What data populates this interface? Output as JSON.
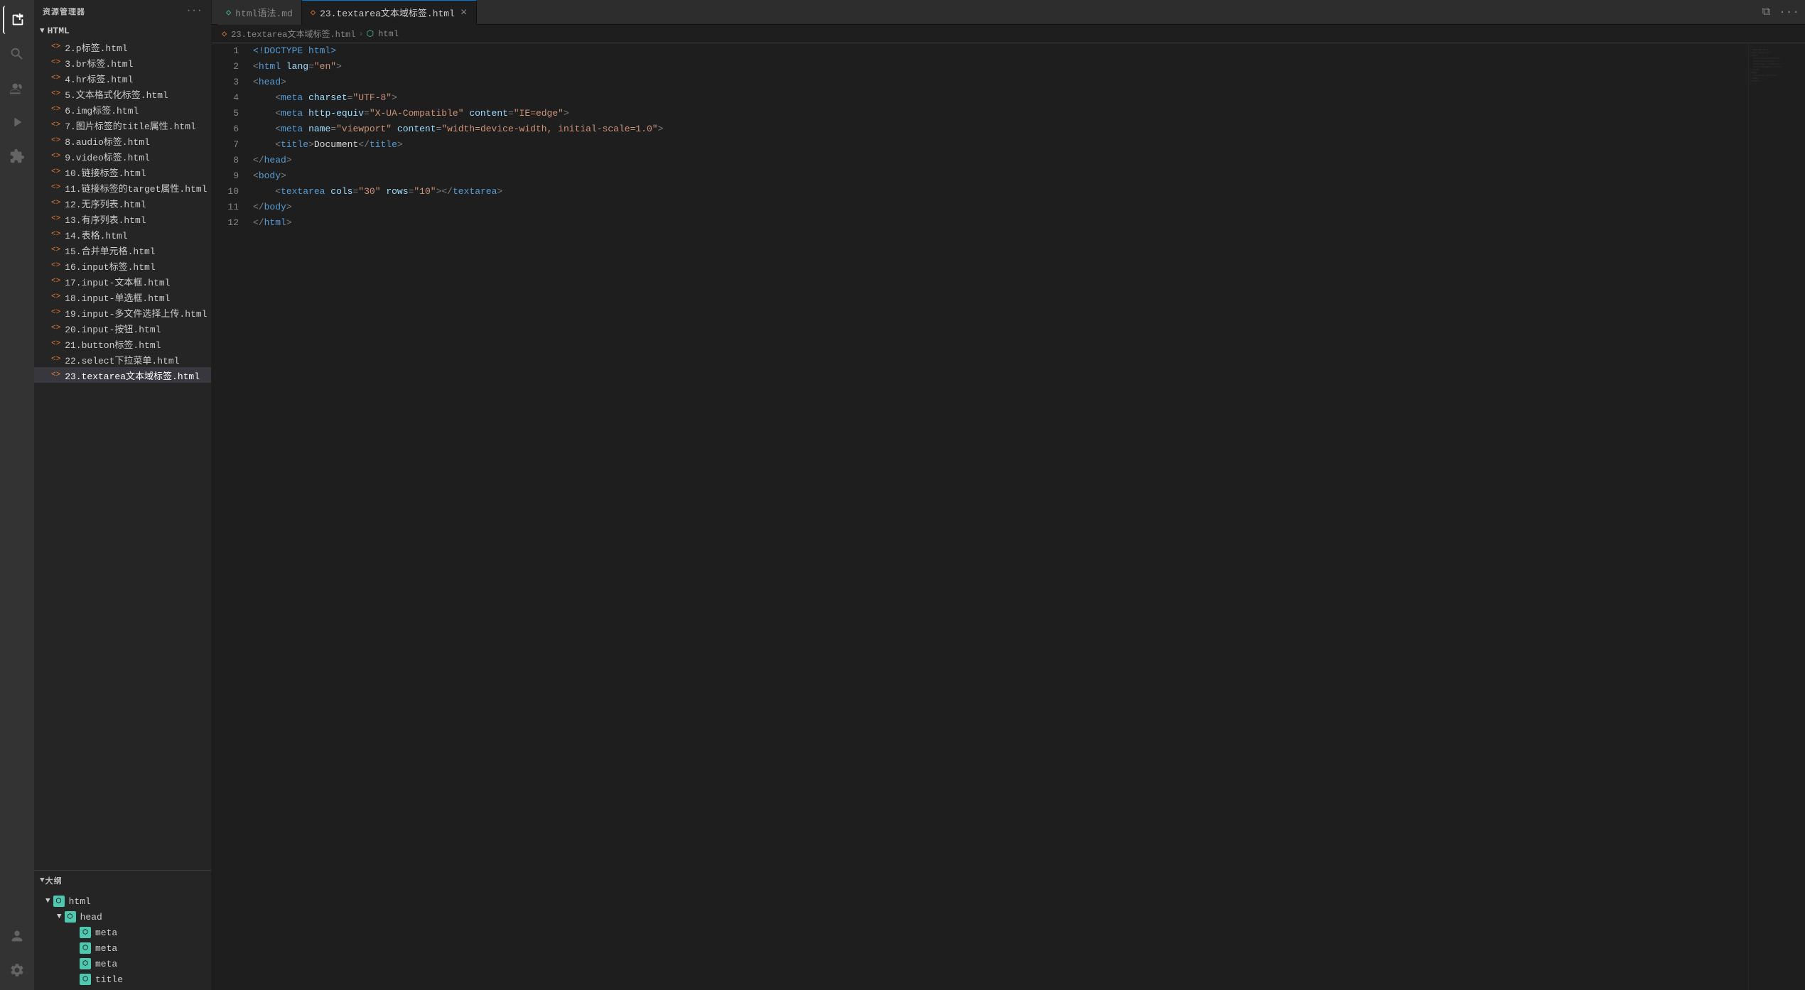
{
  "titleBar": {
    "tabs": [
      {
        "id": "tab-md",
        "icon": "◇",
        "label": "html语法.md",
        "active": false,
        "closable": false,
        "iconColor": "#4ec9b0"
      },
      {
        "id": "tab-html",
        "icon": "◇",
        "label": "23.textarea文本域标签.html",
        "active": true,
        "closable": true,
        "iconColor": "#e37933"
      }
    ]
  },
  "activityBar": {
    "icons": [
      {
        "id": "explorer",
        "symbol": "⎘",
        "active": true,
        "label": "explorer-icon"
      },
      {
        "id": "search",
        "symbol": "🔍",
        "active": false,
        "label": "search-icon"
      },
      {
        "id": "source-control",
        "symbol": "⑂",
        "active": false,
        "label": "source-control-icon"
      },
      {
        "id": "run",
        "symbol": "▷",
        "active": false,
        "label": "run-icon"
      },
      {
        "id": "extensions",
        "symbol": "⊞",
        "active": false,
        "label": "extensions-icon"
      }
    ],
    "bottomIcons": [
      {
        "id": "account",
        "symbol": "👤",
        "label": "account-icon"
      },
      {
        "id": "settings",
        "symbol": "⚙",
        "label": "settings-icon"
      }
    ]
  },
  "sidebar": {
    "header": "资源管理器",
    "sectionLabel": "HTML",
    "files": [
      {
        "id": "file-2",
        "name": "2.p标签.html",
        "active": false
      },
      {
        "id": "file-3",
        "name": "3.br标签.html",
        "active": false
      },
      {
        "id": "file-4",
        "name": "4.hr标签.html",
        "active": false
      },
      {
        "id": "file-5",
        "name": "5.文本格式化标签.html",
        "active": false
      },
      {
        "id": "file-6",
        "name": "6.img标签.html",
        "active": false
      },
      {
        "id": "file-7",
        "name": "7.图片标签的title属性.html",
        "active": false
      },
      {
        "id": "file-8",
        "name": "8.audio标签.html",
        "active": false
      },
      {
        "id": "file-9",
        "name": "9.video标签.html",
        "active": false
      },
      {
        "id": "file-10",
        "name": "10.链接标签.html",
        "active": false
      },
      {
        "id": "file-11",
        "name": "11.链接标签的target属性.html",
        "active": false
      },
      {
        "id": "file-12",
        "name": "12.无序列表.html",
        "active": false
      },
      {
        "id": "file-13",
        "name": "13.有序列表.html",
        "active": false
      },
      {
        "id": "file-14",
        "name": "14.表格.html",
        "active": false
      },
      {
        "id": "file-15",
        "name": "15.合并单元格.html",
        "active": false
      },
      {
        "id": "file-16",
        "name": "16.input标签.html",
        "active": false
      },
      {
        "id": "file-17",
        "name": "17.input-文本框.html",
        "active": false
      },
      {
        "id": "file-18",
        "name": "18.input-单选框.html",
        "active": false
      },
      {
        "id": "file-19",
        "name": "19.input-多文件选择上传.html",
        "active": false
      },
      {
        "id": "file-20",
        "name": "20.input-按钮.html",
        "active": false
      },
      {
        "id": "file-21",
        "name": "21.button标签.html",
        "active": false
      },
      {
        "id": "file-22",
        "name": "22.select下拉菜单.html",
        "active": false
      },
      {
        "id": "file-23",
        "name": "23.textarea文本域标签.html",
        "active": true
      }
    ]
  },
  "outline": {
    "header": "大纲",
    "items": [
      {
        "id": "outline-html",
        "label": "html",
        "level": 0,
        "expanded": true,
        "hasChevron": true
      },
      {
        "id": "outline-head",
        "label": "head",
        "level": 1,
        "expanded": true,
        "hasChevron": true
      },
      {
        "id": "outline-meta1",
        "label": "meta",
        "level": 2,
        "expanded": false,
        "hasChevron": false
      },
      {
        "id": "outline-meta2",
        "label": "meta",
        "level": 2,
        "expanded": false,
        "hasChevron": false
      },
      {
        "id": "outline-meta3",
        "label": "meta",
        "level": 2,
        "expanded": false,
        "hasChevron": false
      },
      {
        "id": "outline-title",
        "label": "title",
        "level": 2,
        "expanded": false,
        "hasChevron": false
      }
    ]
  },
  "breadcrumb": {
    "file": "23.textarea文本域标签.html",
    "symbol": "html"
  },
  "codeLines": [
    {
      "num": 1,
      "content": "<!DOCTYPE html>"
    },
    {
      "num": 2,
      "content": "<html lang=\"en\">"
    },
    {
      "num": 3,
      "content": "<head>"
    },
    {
      "num": 4,
      "content": "    <meta charset=\"UTF-8\">"
    },
    {
      "num": 5,
      "content": "    <meta http-equiv=\"X-UA-Compatible\" content=\"IE=edge\">"
    },
    {
      "num": 6,
      "content": "    <meta name=\"viewport\" content=\"width=device-width, initial-scale=1.0\">"
    },
    {
      "num": 7,
      "content": "    <title>Document</title>"
    },
    {
      "num": 8,
      "content": "</head>"
    },
    {
      "num": 9,
      "content": "<body>"
    },
    {
      "num": 10,
      "content": "    <textarea cols=\"30\" rows=\"10\"></textarea>"
    },
    {
      "num": 11,
      "content": "</body>"
    },
    {
      "num": 12,
      "content": "</html>"
    }
  ]
}
